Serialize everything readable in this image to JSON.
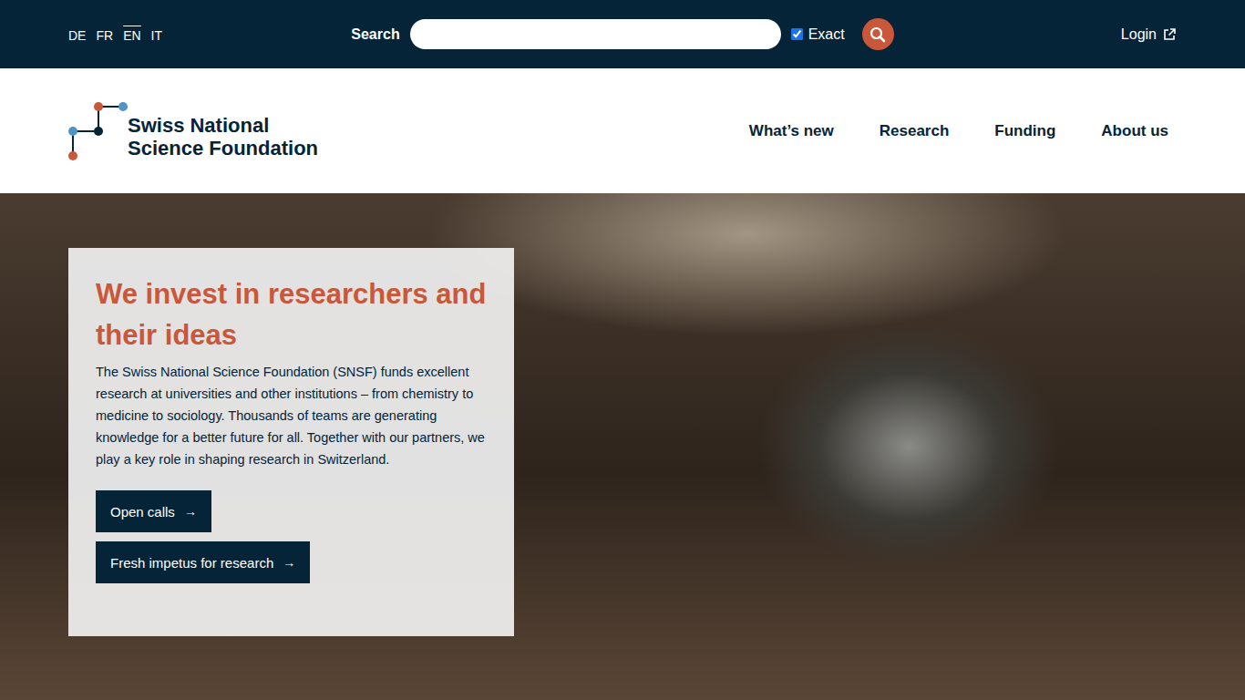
{
  "languages": [
    {
      "label": "DE",
      "selected": false
    },
    {
      "label": "FR",
      "selected": false
    },
    {
      "label": "EN",
      "selected": true
    },
    {
      "label": "IT",
      "selected": false
    }
  ],
  "search": {
    "label": "Search",
    "value": "",
    "exact": {
      "label": "Exact",
      "checked": true
    }
  },
  "login": {
    "label": "Login"
  },
  "logo": {
    "line1": "Swiss National",
    "line2": "Science Foundation"
  },
  "nav": [
    {
      "label": "What’s new"
    },
    {
      "label": "Research"
    },
    {
      "label": "Funding"
    },
    {
      "label": "About us"
    }
  ],
  "hero": {
    "title": "We invest in researchers and their ideas",
    "text": "The Swiss National Science Foundation (SNSF) funds excellent research at universities and other institutions – from chemistry to medicine to sociology. Thousands of teams are generating knowledge for a better future for all. Together with our partners, we play a key role in shaping research in Switzerland.",
    "buttons": [
      {
        "label": "Open calls",
        "arrow": "→"
      },
      {
        "label": "Fresh impetus for research",
        "arrow": "→"
      }
    ]
  }
}
